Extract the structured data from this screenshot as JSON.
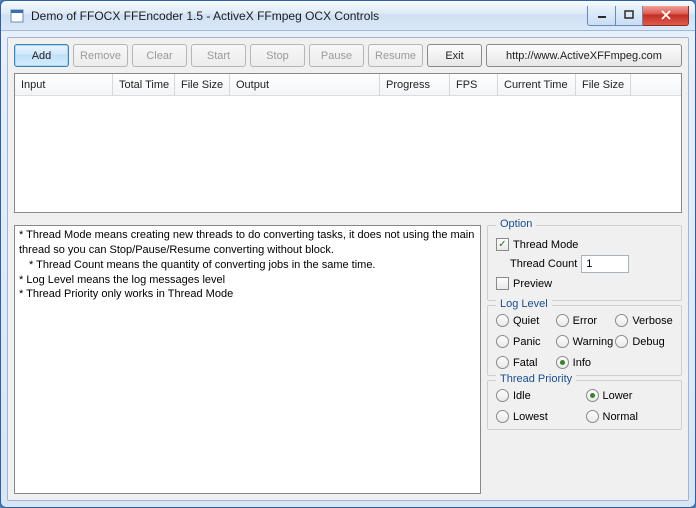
{
  "title": "Demo of FFOCX FFEncoder 1.5 - ActiveX FFmpeg OCX Controls",
  "toolbar": {
    "add": "Add",
    "remove": "Remove",
    "clear": "Clear",
    "start": "Start",
    "stop": "Stop",
    "pause": "Pause",
    "resume": "Resume",
    "exit": "Exit",
    "url": "http://www.ActiveXFFmpeg.com"
  },
  "columns": [
    "Input",
    "Total Time",
    "File Size",
    "Output",
    "Progress",
    "FPS",
    "Current Time",
    "File Size"
  ],
  "log": {
    "l1": "* Thread Mode means creating new threads to do converting tasks, it does not using the main thread so you can Stop/Pause/Resume converting without block.",
    "l2": "* Thread Count means the quantity of converting jobs in the same time.",
    "l3": "* Log Level means the log messages level",
    "l4": "* Thread Priority only works in Thread Mode"
  },
  "option": {
    "title": "Option",
    "thread_mode": "Thread Mode",
    "thread_mode_checked": true,
    "thread_count_label": "Thread Count",
    "thread_count_value": "1",
    "preview": "Preview",
    "preview_checked": false
  },
  "loglevel": {
    "title": "Log Level",
    "items": [
      "Quiet",
      "Error",
      "Verbose",
      "Panic",
      "Warning",
      "Debug",
      "Fatal",
      "Info"
    ],
    "selected": "Info"
  },
  "priority": {
    "title": "Thread Priority",
    "items": [
      "Idle",
      "Lower",
      "Lowest",
      "Normal"
    ],
    "selected": "Lower"
  }
}
